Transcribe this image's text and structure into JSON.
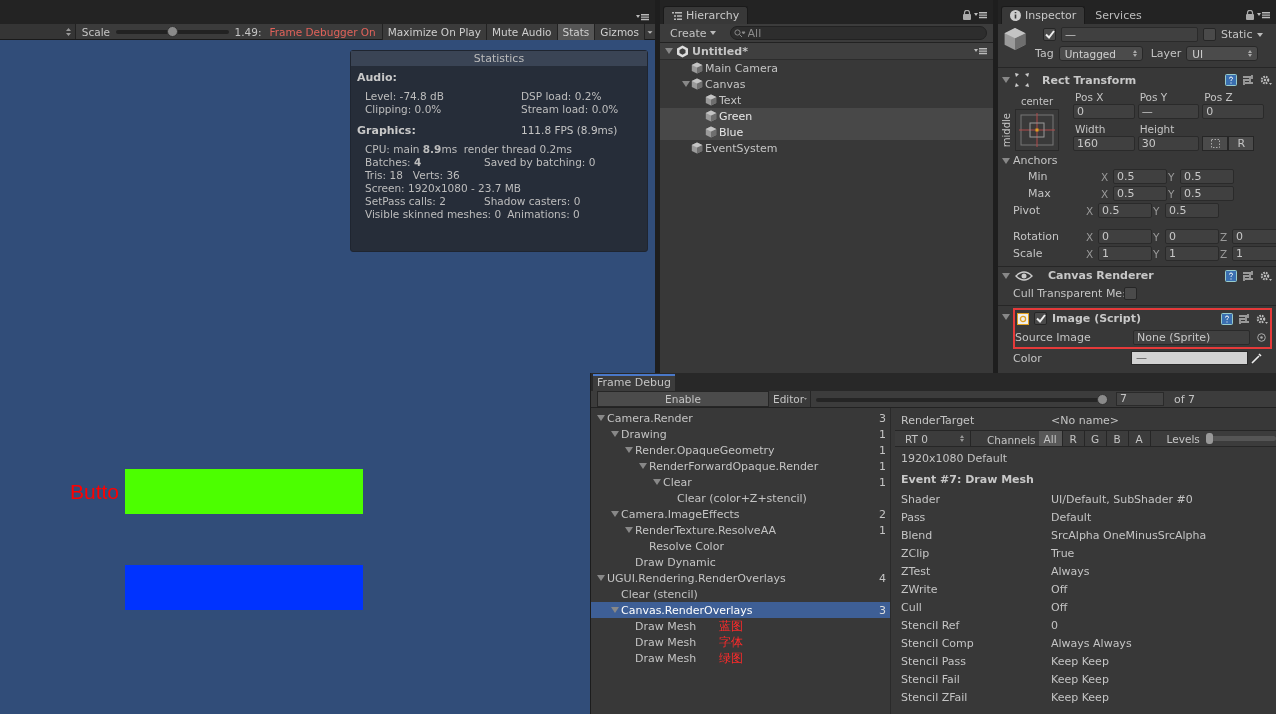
{
  "game_view": {
    "toolbar": {
      "scale_label": "Scale",
      "scale_slider": {
        "level": 0.5
      },
      "scale_value": "1.49:",
      "status": "Frame Debugger On",
      "buttons": [
        {
          "label": "Maximize On Play",
          "selected": false
        },
        {
          "label": "Mute Audio",
          "selected": false
        },
        {
          "label": "Stats",
          "selected": true
        },
        {
          "label": "Gizmos",
          "selected": false
        }
      ]
    },
    "statistics": {
      "title": "Statistics",
      "audio_heading": "Audio:",
      "audio_rows": [
        {
          "left": "Level: -74.8 dB",
          "right": "DSP load: 0.2%"
        },
        {
          "left": "Clipping: 0.0%",
          "right": "Stream load: 0.0%"
        }
      ],
      "graphics_heading": "Graphics:",
      "fps": "111.8 FPS (8.9ms)",
      "graphics_rows": [
        {
          "left": "CPU: main **8.9**ms  render thread 0.2ms"
        },
        {
          "left": "Batches: **4**",
          "right": "Saved by batching: 0"
        },
        {
          "left": "Tris: 18   Verts: 36"
        },
        {
          "left": "Screen: 1920x1080 - 23.7 MB"
        },
        {
          "left": "SetPass calls: 2",
          "right": "Shadow casters: 0"
        },
        {
          "left": "Visible skinned meshes: 0",
          "right": "Animations: 0"
        }
      ]
    },
    "canvas": {
      "text": "Butto",
      "rects": [
        {
          "color": "#4cff00"
        },
        {
          "color": "#0033ff"
        }
      ]
    }
  },
  "hierarchy": {
    "tab": "Hierarchy",
    "create": "Create",
    "search_placeholder": "All",
    "scene": "Untitled*",
    "items": [
      {
        "label": "Main Camera",
        "selected": false
      },
      {
        "label": "Canvas",
        "selected": false,
        "expanded": true,
        "children": [
          {
            "label": "Text",
            "selected": false
          },
          {
            "label": "Green",
            "selected": true
          },
          {
            "label": "Blue",
            "selected": true
          }
        ]
      },
      {
        "label": "EventSystem",
        "selected": false
      }
    ]
  },
  "inspector": {
    "tabs": [
      {
        "label": "Inspector",
        "selected": true
      },
      {
        "label": "Services",
        "selected": false
      }
    ],
    "object": {
      "active": true,
      "name": "—",
      "static_label": "Static",
      "static": false,
      "tag_label": "Tag",
      "tag": "Untagged",
      "layer_label": "Layer",
      "layer": "UI"
    },
    "rect_transform": {
      "title": "Rect Transform",
      "preset_horizontal": "center",
      "preset_vertical": "middle",
      "position": [
        {
          "label": "Pos X",
          "value": "0"
        },
        {
          "label": "Pos Y",
          "value": "—"
        },
        {
          "label": "Pos Z",
          "value": "0"
        }
      ],
      "size": [
        {
          "label": "Width",
          "value": "160"
        },
        {
          "label": "Height",
          "value": "30"
        }
      ],
      "raw_button": "R",
      "anchors_label": "Anchors",
      "anchors_expanded": true,
      "anchor_rows": [
        {
          "label": "Min",
          "axes": [
            {
              "axis": "X",
              "value": "0.5"
            },
            {
              "axis": "Y",
              "value": "0.5"
            }
          ]
        },
        {
          "label": "Max",
          "axes": [
            {
              "axis": "X",
              "value": "0.5"
            },
            {
              "axis": "Y",
              "value": "0.5"
            }
          ]
        }
      ],
      "pivot": {
        "label": "Pivot",
        "axes": [
          {
            "axis": "X",
            "value": "0.5"
          },
          {
            "axis": "Y",
            "value": "0.5"
          }
        ]
      },
      "transform_rows": [
        {
          "label": "Rotation",
          "axes": [
            {
              "axis": "X",
              "value": "0"
            },
            {
              "axis": "Y",
              "value": "0"
            },
            {
              "axis": "Z",
              "value": "0"
            }
          ]
        },
        {
          "label": "Scale",
          "axes": [
            {
              "axis": "X",
              "value": "1"
            },
            {
              "axis": "Y",
              "value": "1"
            },
            {
              "axis": "Z",
              "value": "1"
            }
          ]
        }
      ]
    },
    "canvas_renderer": {
      "title": "Canvas Renderer",
      "cull_label": "Cull Transparent Me:",
      "cull": false
    },
    "image": {
      "title": "Image (Script)",
      "enabled": true,
      "highlighted": true,
      "source_label": "Source Image",
      "source_value": "None (Sprite)",
      "color_label": "Color",
      "color_value": "—"
    }
  },
  "frame_debug": {
    "tab": "Frame Debug",
    "enable": "Enable",
    "target": "Editor",
    "event_slider": {
      "level": 1
    },
    "event": "7",
    "event_total": "of 7",
    "events": [
      {
        "label": "Camera.Render",
        "count": "3",
        "selected": false,
        "expanded": true,
        "children": [
          {
            "label": "Drawing",
            "count": "1",
            "selected": false,
            "expanded": true,
            "children": [
              {
                "label": "Render.OpaqueGeometry",
                "count": "1",
                "selected": false,
                "expanded": true,
                "children": [
                  {
                    "label": "RenderForwardOpaque.Render",
                    "count": "1",
                    "selected": false,
                    "expanded": true,
                    "children": [
                      {
                        "label": "Clear",
                        "count": "1",
                        "selected": false,
                        "expanded": true,
                        "children": [
                          {
                            "label": "Clear (color+Z+stencil)",
                            "selected": false
                          }
                        ]
                      }
                    ]
                  }
                ]
              }
            ]
          },
          {
            "label": "Camera.ImageEffects",
            "count": "2",
            "selected": false,
            "expanded": true,
            "children": [
              {
                "label": "RenderTexture.ResolveAA",
                "count": "1",
                "selected": false,
                "expanded": true,
                "children": [
                  {
                    "label": "Resolve Color",
                    "selected": false
                  }
                ]
              },
              {
                "label": "Draw Dynamic",
                "selected": false
              }
            ]
          }
        ]
      },
      {
        "label": "UGUI.Rendering.RenderOverlays",
        "count": "4",
        "selected": false,
        "expanded": true,
        "children": [
          {
            "label": "Clear (stencil)",
            "selected": false
          },
          {
            "label": "Canvas.RenderOverlays",
            "count": "3",
            "selected": true,
            "expanded": true,
            "children": [
              {
                "label": "Draw Mesh",
                "note": "蓝图",
                "selected": false
              },
              {
                "label": "Draw Mesh",
                "note": "字体",
                "selected": false
              },
              {
                "label": "Draw Mesh",
                "note": "绿图",
                "selected": false
              }
            ]
          }
        ]
      }
    ],
    "render_target_label": "RenderTarget",
    "render_target": "<No name>",
    "rt": "RT 0",
    "channels_label": "Channels",
    "channels": [
      {
        "label": "All",
        "selected": true
      },
      {
        "label": "R",
        "selected": false
      },
      {
        "label": "G",
        "selected": false
      },
      {
        "label": "B",
        "selected": false
      },
      {
        "label": "A",
        "selected": false
      }
    ],
    "levels_label": "Levels",
    "levels_slider": {
      "level": 0
    },
    "resolution": "1920x1080 Default",
    "event_title": "Event #7: Draw Mesh",
    "properties": [
      {
        "name": "Shader",
        "value": "UI/Default, SubShader #0"
      },
      {
        "name": "Pass",
        "value": "Default"
      },
      {
        "name": "Blend",
        "value": "SrcAlpha OneMinusSrcAlpha"
      },
      {
        "name": "ZClip",
        "value": "True"
      },
      {
        "name": "ZTest",
        "value": "Always"
      },
      {
        "name": "ZWrite",
        "value": "Off"
      },
      {
        "name": "Cull",
        "value": "Off"
      },
      {
        "name": "Stencil Ref",
        "value": "0"
      },
      {
        "name": "Stencil Comp",
        "value": "Always Always"
      },
      {
        "name": "Stencil Pass",
        "value": "Keep Keep"
      },
      {
        "name": "Stencil Fail",
        "value": "Keep Keep"
      },
      {
        "name": "Stencil ZFail",
        "value": "Keep Keep"
      }
    ]
  }
}
